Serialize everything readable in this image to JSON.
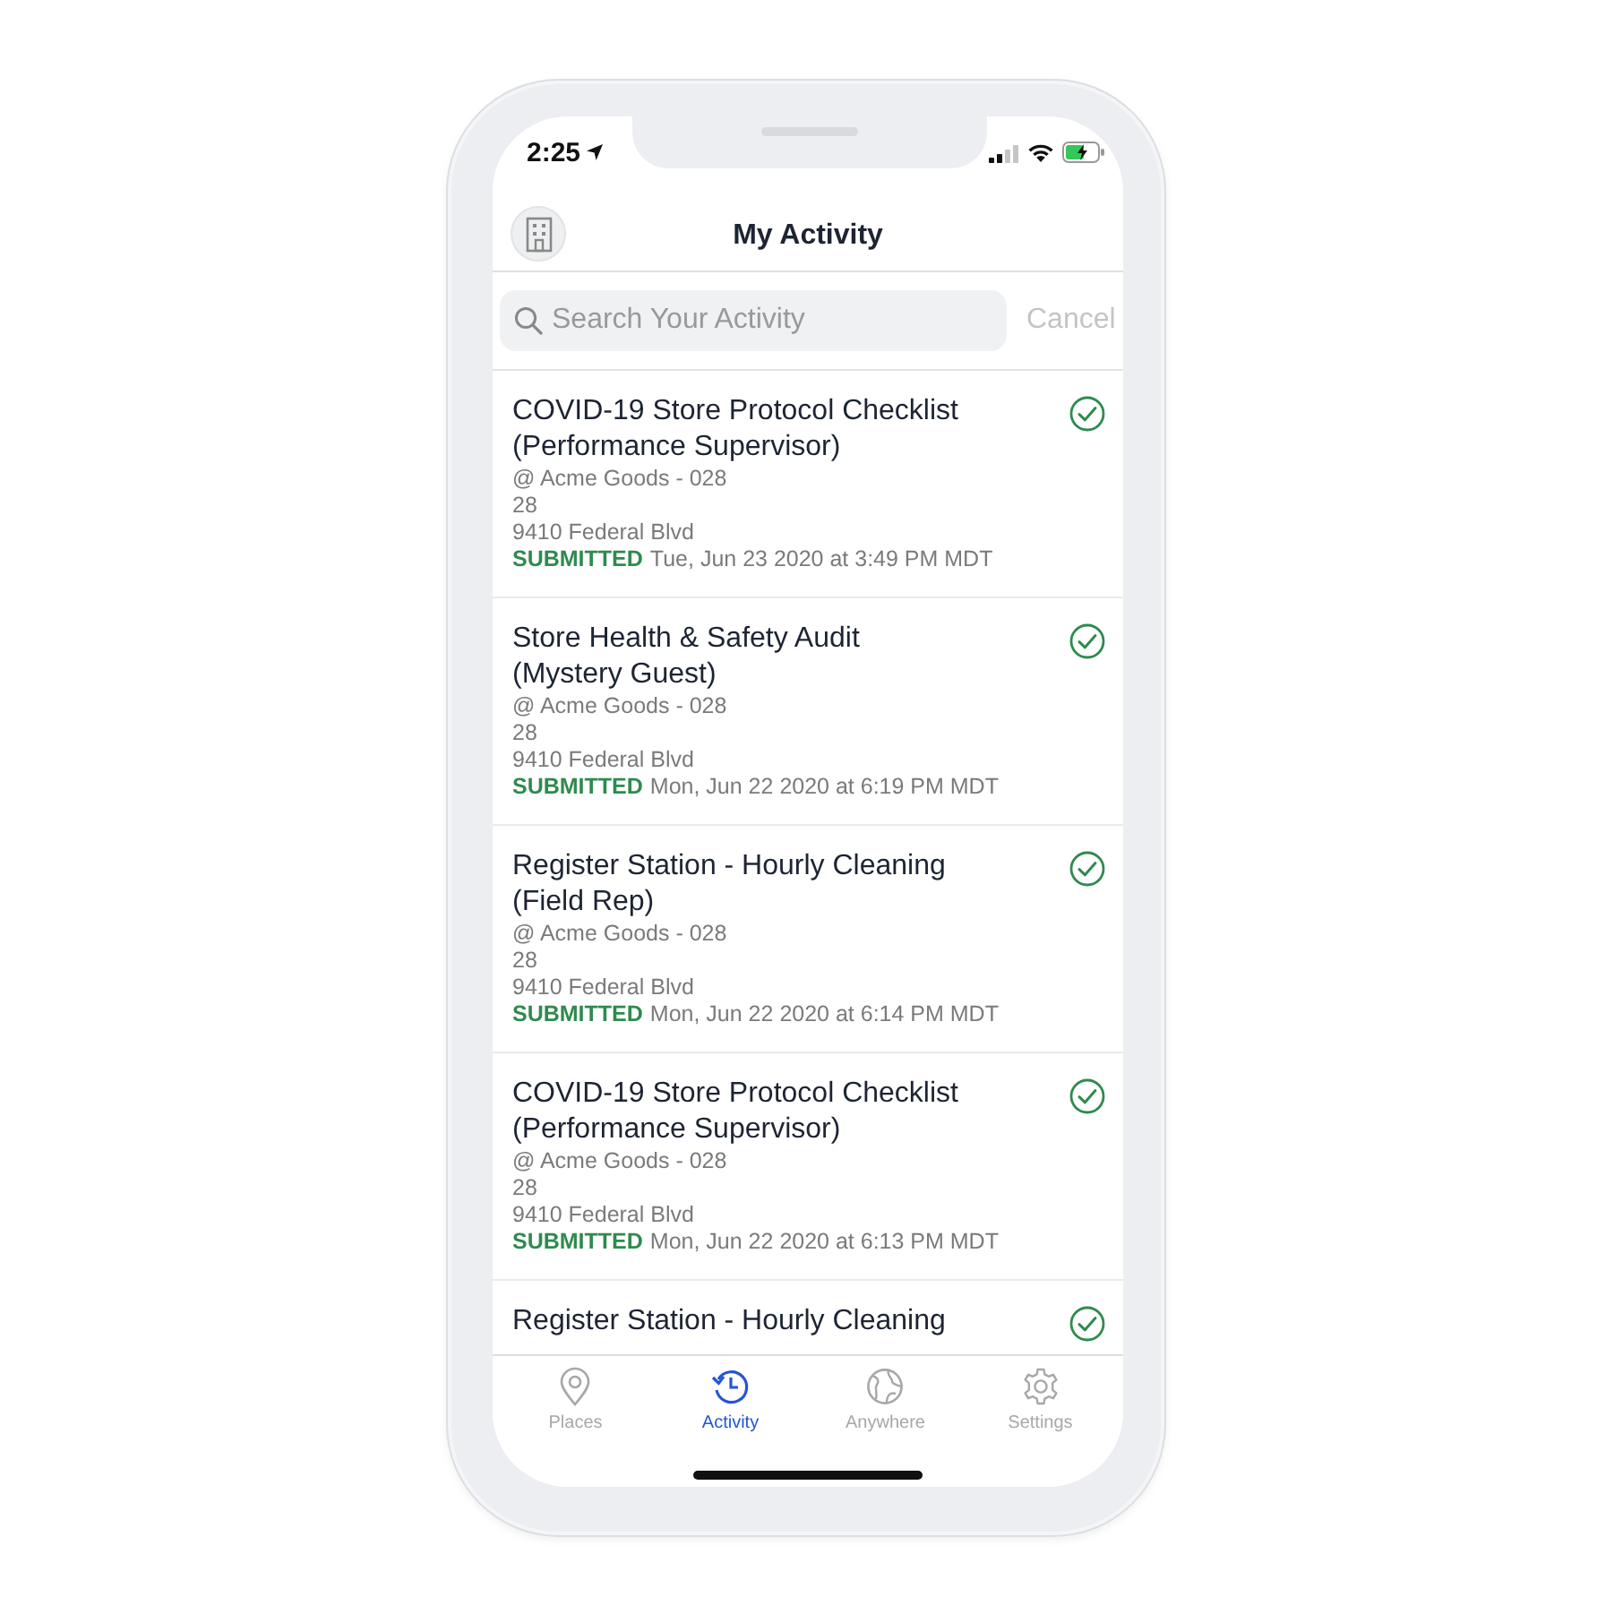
{
  "status_bar": {
    "time": "2:25"
  },
  "header": {
    "title": "My Activity"
  },
  "search": {
    "placeholder": "Search Your Activity",
    "cancel": "Cancel"
  },
  "activities": [
    {
      "title_lines": [
        "COVID-19 Store Protocol Checklist",
        "(Performance Supervisor)"
      ],
      "place": "@ Acme Goods - 028",
      "number": "28",
      "address": "9410 Federal Blvd",
      "status": "SUBMITTED",
      "date": "Tue, Jun 23 2020 at 3:49 PM MDT",
      "completed": true
    },
    {
      "title_lines": [
        "Store Health & Safety Audit",
        "(Mystery Guest)"
      ],
      "place": "@ Acme Goods - 028",
      "number": "28",
      "address": "9410 Federal Blvd",
      "status": "SUBMITTED",
      "date": "Mon, Jun 22 2020 at 6:19 PM MDT",
      "completed": true
    },
    {
      "title_lines": [
        "Register Station - Hourly Cleaning",
        "(Field Rep)"
      ],
      "place": "@ Acme Goods - 028",
      "number": "28",
      "address": "9410 Federal Blvd",
      "status": "SUBMITTED",
      "date": "Mon, Jun 22 2020 at 6:14 PM MDT",
      "completed": true
    },
    {
      "title_lines": [
        "COVID-19 Store Protocol Checklist",
        "(Performance Supervisor)"
      ],
      "place": "@ Acme Goods - 028",
      "number": "28",
      "address": "9410 Federal Blvd",
      "status": "SUBMITTED",
      "date": "Mon, Jun 22 2020 at 6:13 PM MDT",
      "completed": true
    },
    {
      "title_lines": [
        "Register Station - Hourly Cleaning"
      ],
      "completed": true
    }
  ],
  "tabs": [
    {
      "kind": "pin",
      "label": "Places",
      "selected": false
    },
    {
      "kind": "history",
      "label": "Activity",
      "selected": true
    },
    {
      "kind": "globe",
      "label": "Anywhere",
      "selected": false
    },
    {
      "kind": "gear",
      "label": "Settings",
      "selected": false
    }
  ]
}
